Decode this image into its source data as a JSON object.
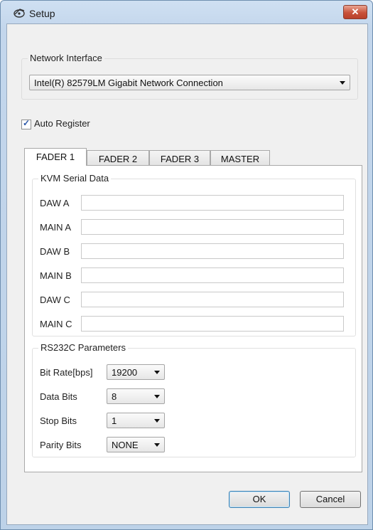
{
  "window": {
    "title": "Setup",
    "close_label": "✕"
  },
  "network": {
    "group_label": "Network Interface",
    "selected": "Intel(R) 82579LM Gigabit Network Connection"
  },
  "auto_register": {
    "label": "Auto Register",
    "checked": true
  },
  "tabs": [
    {
      "label": "FADER 1",
      "active": true
    },
    {
      "label": "FADER 2",
      "active": false
    },
    {
      "label": "FADER 3",
      "active": false
    },
    {
      "label": "MASTER",
      "active": false
    }
  ],
  "kvm": {
    "group_label": "KVM Serial Data",
    "fields": [
      {
        "label": "DAW A",
        "value": ""
      },
      {
        "label": "MAIN A",
        "value": ""
      },
      {
        "label": "DAW B",
        "value": ""
      },
      {
        "label": "MAIN B",
        "value": ""
      },
      {
        "label": "DAW C",
        "value": ""
      },
      {
        "label": "MAIN C",
        "value": ""
      }
    ]
  },
  "rs232c": {
    "group_label": "RS232C Parameters",
    "params": [
      {
        "label": "Bit Rate[bps]",
        "value": "19200"
      },
      {
        "label": "Data Bits",
        "value": "8"
      },
      {
        "label": "Stop Bits",
        "value": "1"
      },
      {
        "label": "Parity Bits",
        "value": "NONE"
      }
    ]
  },
  "buttons": {
    "ok": "OK",
    "cancel": "Cancel"
  }
}
